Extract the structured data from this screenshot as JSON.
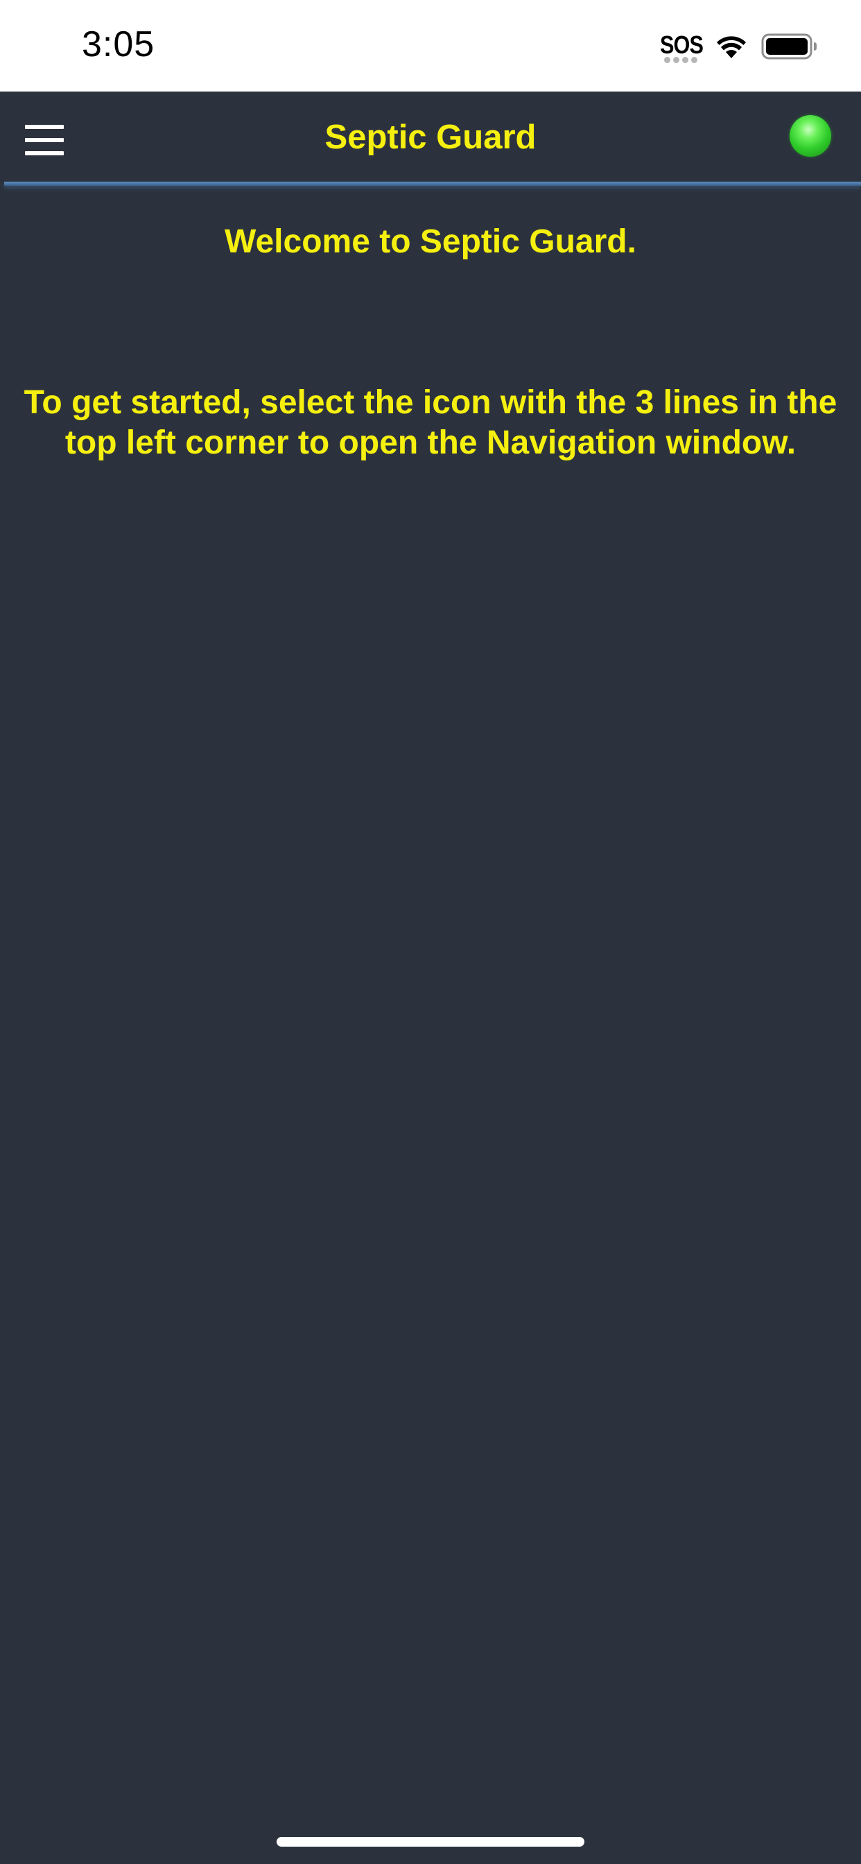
{
  "status_bar": {
    "time": "3:05",
    "sos": "SOS",
    "wifi_icon": "wifi-icon",
    "battery_icon": "battery-icon"
  },
  "header": {
    "title": "Septic Guard",
    "menu_icon": "hamburger-menu-icon",
    "status_indicator_color": "#2fcc2a"
  },
  "main": {
    "welcome": "Welcome to Septic Guard.",
    "instructions": "To get started, select the icon with the 3 lines in the top left corner to open the Navigation window."
  },
  "colors": {
    "background": "#2c323d",
    "accent_text": "#f5f00f",
    "divider": "#5b8fc4"
  }
}
